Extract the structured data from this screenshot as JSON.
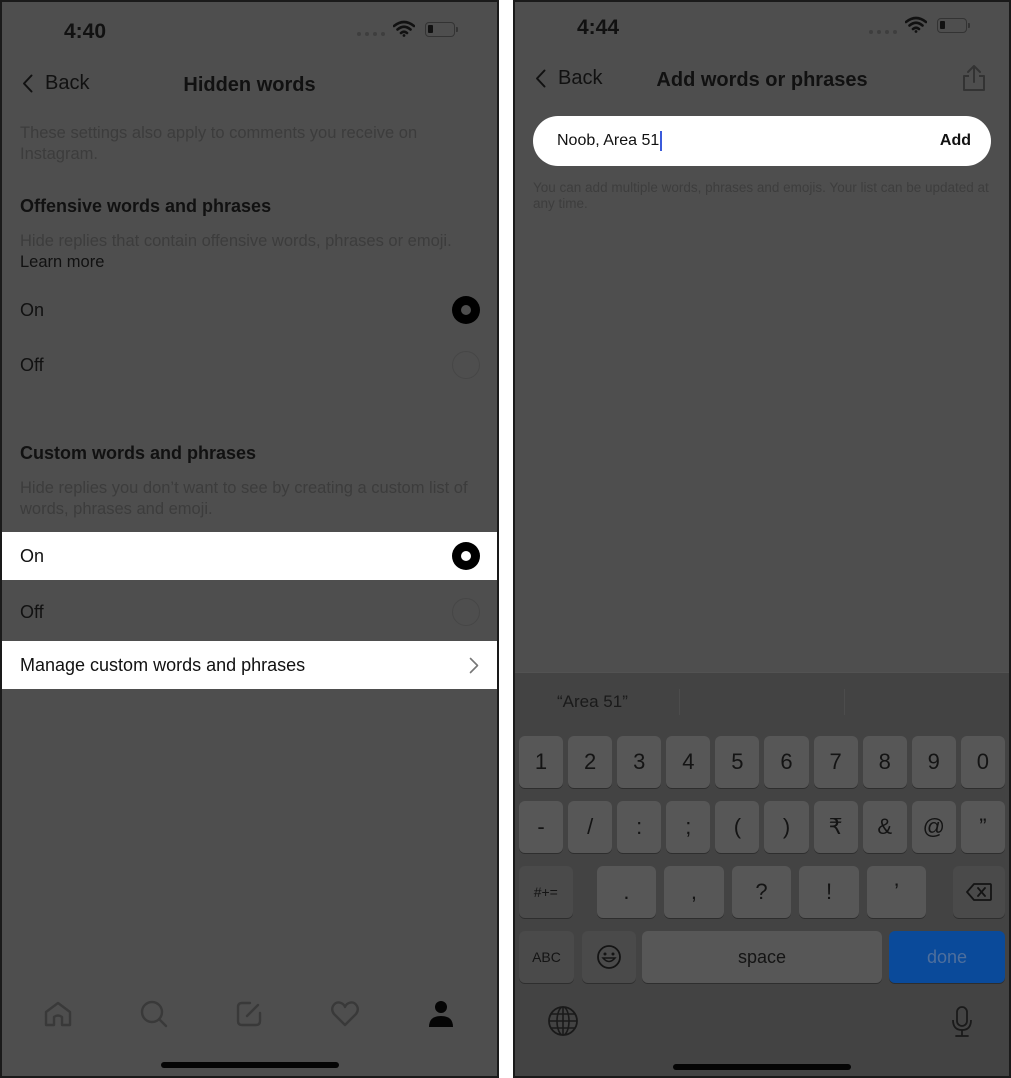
{
  "left_screen": {
    "status": {
      "time": "4:40"
    },
    "nav": {
      "back_label": "Back",
      "title": "Hidden words"
    },
    "intro": "These settings also apply to comments you receive on Instagram.",
    "offensive": {
      "title": "Offensive words and phrases",
      "description": "Hide replies that contain offensive words, phrases or emoji.",
      "learn_more": "Learn more",
      "options": [
        {
          "label": "On",
          "selected": true
        },
        {
          "label": "Off",
          "selected": false
        }
      ]
    },
    "custom": {
      "title": "Custom words and phrases",
      "description": "Hide replies you don’t want to see by creating a custom list of words, phrases and emoji.",
      "options": [
        {
          "label": "On",
          "selected": true
        },
        {
          "label": "Off",
          "selected": false
        }
      ],
      "manage_label": "Manage custom words and phrases"
    },
    "tab_bar": [
      {
        "icon": "home-icon",
        "active": false
      },
      {
        "icon": "search-icon",
        "active": false
      },
      {
        "icon": "create-post-icon",
        "active": false
      },
      {
        "icon": "heart-icon",
        "active": false
      },
      {
        "icon": "profile-icon",
        "active": true
      }
    ]
  },
  "right_screen": {
    "status": {
      "time": "4:44"
    },
    "nav": {
      "back_label": "Back",
      "title": "Add words or phrases",
      "share_icon": "share-icon"
    },
    "input": {
      "value": "Noob, Area 51",
      "add_label": "Add"
    },
    "hint": "You can add multiple words, phrases and emojis. Your list can be updated at any time.",
    "keyboard": {
      "suggestions": [
        "“Area 51”",
        "",
        ""
      ],
      "row1": [
        "1",
        "2",
        "3",
        "4",
        "5",
        "6",
        "7",
        "8",
        "9",
        "0"
      ],
      "row2": [
        "-",
        "/",
        ":",
        ";",
        "(",
        ")",
        "₹",
        "&",
        "@",
        "”"
      ],
      "row3": {
        "shift_label": "#+=",
        "keys": [
          ".",
          ",",
          "?",
          "!",
          "’"
        ],
        "delete_icon": "delete-icon"
      },
      "row4": {
        "abc_label": "ABC",
        "emoji_icon": "emoji-icon",
        "space_label": "space",
        "done_label": "done"
      },
      "globe_icon": "globe-icon",
      "mic_icon": "microphone-icon"
    }
  },
  "colors": {
    "overlay_bg": "#4e4e4e",
    "highlight_bg": "#ffffff",
    "done_key": "#0a4a9a",
    "caret": "#3b5bdb"
  }
}
